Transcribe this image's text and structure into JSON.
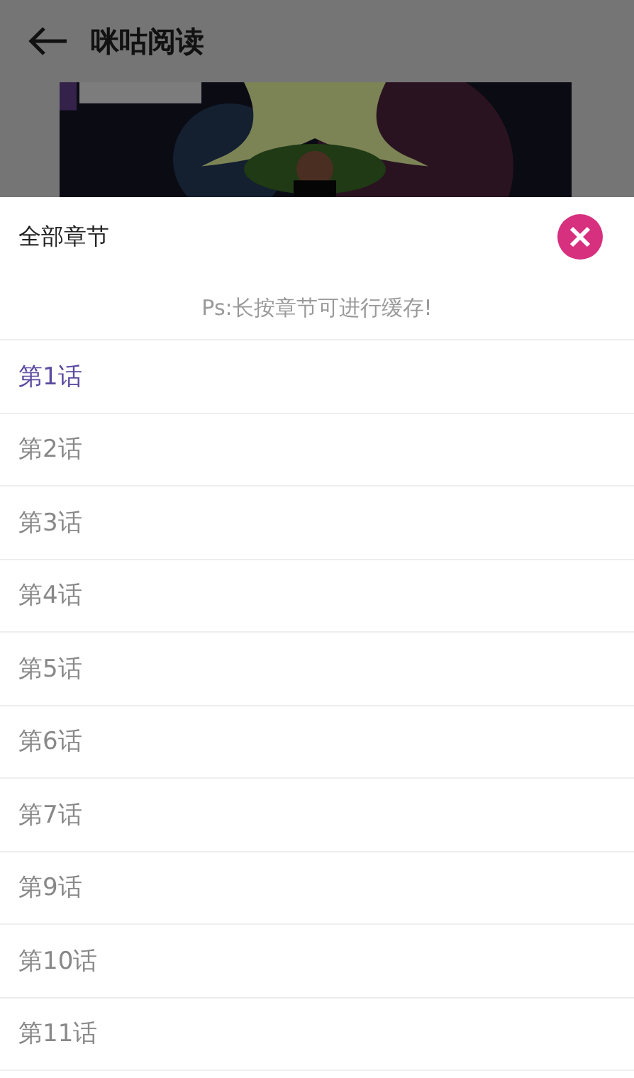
{
  "app_bar": {
    "title": "咪咕阅读"
  },
  "chapter_sheet": {
    "title": "全部章节",
    "hint": "Ps:长按章节可进行缓存!",
    "chapters": [
      {
        "label": "第1话",
        "selected": true
      },
      {
        "label": "第2话",
        "selected": false
      },
      {
        "label": "第3话",
        "selected": false
      },
      {
        "label": "第4话",
        "selected": false
      },
      {
        "label": "第5话",
        "selected": false
      },
      {
        "label": "第6话",
        "selected": false
      },
      {
        "label": "第7话",
        "selected": false
      },
      {
        "label": "第9话",
        "selected": false
      },
      {
        "label": "第10话",
        "selected": false
      },
      {
        "label": "第11话",
        "selected": false
      }
    ]
  }
}
